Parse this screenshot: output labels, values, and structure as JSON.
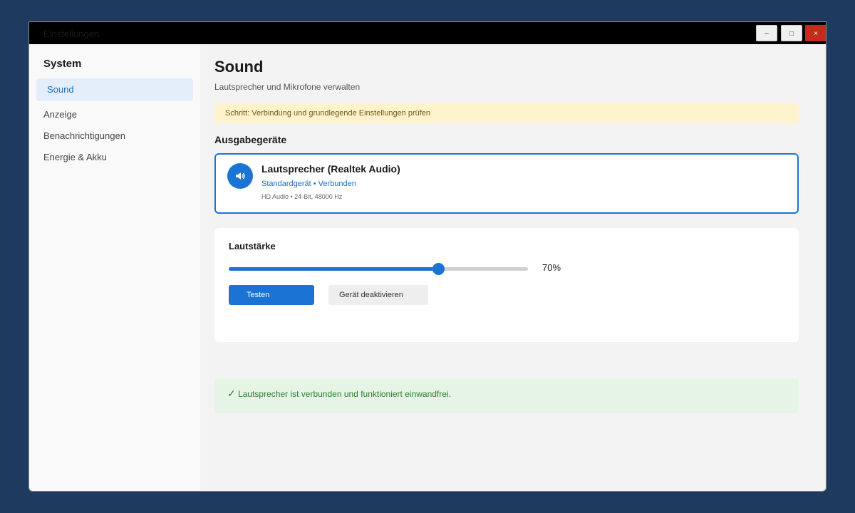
{
  "window": {
    "title": "Einstellungen",
    "controls": {
      "minimize": "–",
      "maximize": "□",
      "close": "×"
    }
  },
  "sidebar": {
    "title": "System",
    "items": [
      {
        "label": "Sound",
        "active": true
      },
      {
        "label": "Anzeige",
        "active": false
      },
      {
        "label": "Benachrichtigungen",
        "active": false
      },
      {
        "label": "Energie & Akku",
        "active": false
      }
    ]
  },
  "page": {
    "title": "Sound",
    "subtitle": "Lautsprecher und Mikrofone verwalten",
    "step_notice": "Schritt: Verbindung und grundlegende Einstellungen prüfen",
    "output_section_title": "Ausgabegeräte"
  },
  "device": {
    "icon": "speaker-icon",
    "name": "Lautsprecher (Realtek Audio)",
    "status": "Standardgerät • Verbunden",
    "info": "HD Audio • 24-Bit, 48000 Hz"
  },
  "volume": {
    "label": "Lautstärke",
    "value_percent": 70,
    "value_text": "70%",
    "test_button": "Testen",
    "disable_button": "Gerät deaktivieren"
  },
  "success_message": {
    "icon": "checkmark-icon",
    "check": "✓",
    "text": "Lautsprecher ist verbunden und funktioniert einwandfrei."
  },
  "colors": {
    "accent": "#1b74d4",
    "background": "#1f3a5f",
    "close_button": "#c42b1c",
    "success_bg": "#e6f4e6",
    "success_text": "#2e7d32",
    "notice_bg": "#fff3cd"
  }
}
